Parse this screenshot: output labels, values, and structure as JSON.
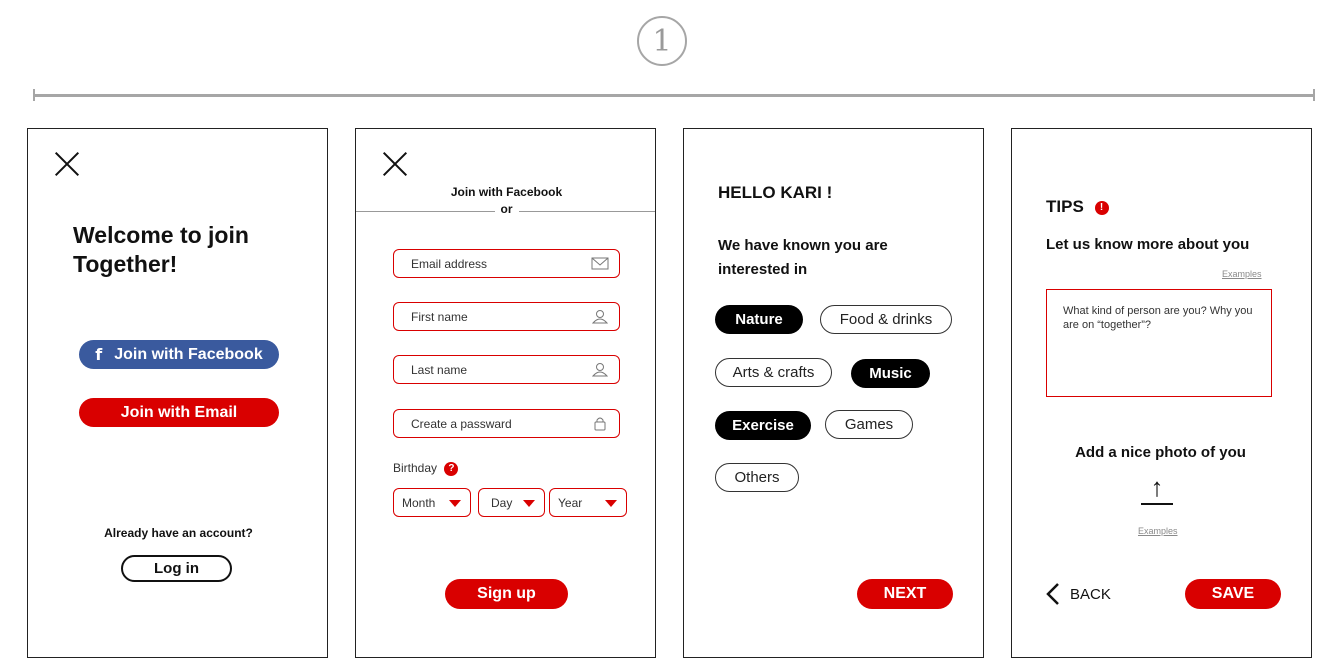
{
  "step": {
    "number": "1"
  },
  "screen1": {
    "title": "Welcome to join Together!",
    "facebook_label": "Join with Facebook",
    "facebook_letter": "f",
    "email_label": "Join with Email",
    "account_prompt": "Already have an account?",
    "login_label": "Log in"
  },
  "screen2": {
    "facebook_header": "Join with Facebook",
    "or_text": "or",
    "fields": [
      {
        "placeholder": "Email address",
        "icon": "envelope-icon"
      },
      {
        "placeholder": "First name",
        "icon": "user-icon"
      },
      {
        "placeholder": "Last name",
        "icon": "user-icon"
      },
      {
        "placeholder": "Create a passward",
        "icon": "lock-icon"
      }
    ],
    "birthday_label": "Birthday",
    "birthday_help": "?",
    "month": "Month",
    "day": "Day",
    "year": "Year",
    "signup_label": "Sign up"
  },
  "screen3": {
    "greeting": "HELLO KARI !",
    "subtitle": "We have known you are interested in",
    "tags": [
      {
        "label": "Nature",
        "selected": true
      },
      {
        "label": "Food & drinks",
        "selected": false
      },
      {
        "label": "Arts & crafts",
        "selected": false
      },
      {
        "label": "Music",
        "selected": true
      },
      {
        "label": "Exercise",
        "selected": true
      },
      {
        "label": "Games",
        "selected": false
      },
      {
        "label": "Others",
        "selected": false
      }
    ],
    "next_label": "NEXT"
  },
  "screen4": {
    "title": "TIPS",
    "warn": "!",
    "heading": "Let us know more about you",
    "examples_top": "Examples",
    "textarea_placeholder": "What kind of person are you? Why you are on “together”?",
    "photo_heading": "Add a nice photo of you",
    "upload_arrow": "↑",
    "examples_bottom": "Examples",
    "back_label": "BACK",
    "save_label": "SAVE"
  },
  "colors": {
    "accent": "#d90000",
    "facebook": "#3a5a9e",
    "grey": "#a6a6a6"
  }
}
